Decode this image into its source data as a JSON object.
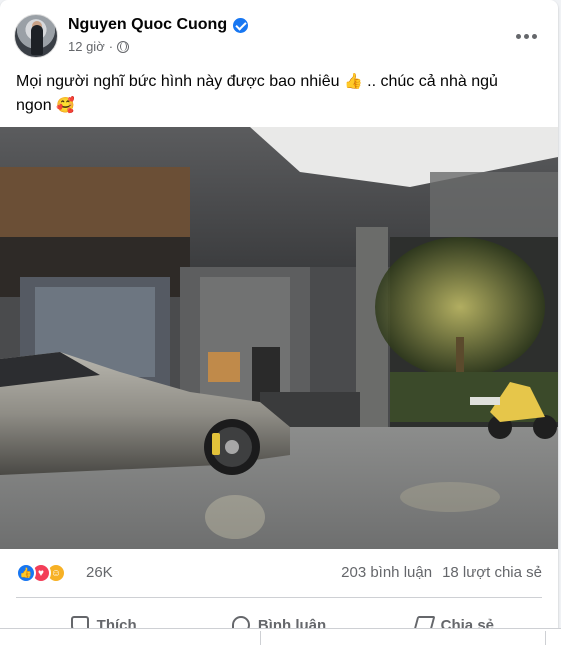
{
  "post": {
    "author": "Nguyen Quoc Cuong",
    "time": "12 giờ",
    "text": "Mọi người nghĩ bức hình này được bao nhiêu",
    "text_mid": ".. chúc cả nhà ngủ ngon",
    "emoji_1": "👍",
    "emoji_2": "🥰",
    "verified_color": "#1877f2"
  },
  "stats": {
    "reaction_count": "26K",
    "comments": "203 bình luận",
    "shares": "18 lượt chia sẻ",
    "reaction_icons": [
      "like-icon",
      "love-icon",
      "care-icon"
    ]
  },
  "actions": {
    "like": "Thích",
    "comment": "Bình luận",
    "share": "Chia sẻ"
  }
}
